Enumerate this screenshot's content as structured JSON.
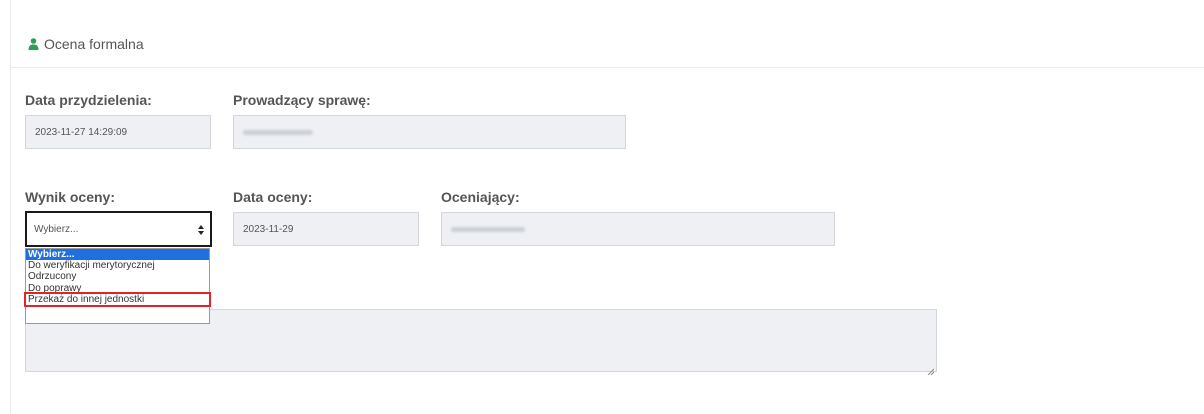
{
  "panel": {
    "title": "Ocena formalna",
    "icon": "user-icon"
  },
  "assignment": {
    "date_label": "Data przydzielenia:",
    "date_value": "2023-11-27 14:29:09",
    "handler_label": "Prowadzący sprawę:"
  },
  "evaluation": {
    "result_label": "Wynik oceny:",
    "result_selected": "Wybierz...",
    "date_label": "Data oceny:",
    "date_value": "2023-11-29",
    "evaluator_label": "Oceniający:"
  },
  "dropdown": {
    "options": [
      "Wybierz...",
      "Do weryfikacji merytorycznej",
      "Odrzucony",
      "Do poprawy",
      "Przekaż do innej jednostki"
    ],
    "selected_option": "Wybierz...",
    "highlight_color": "#e0242a",
    "selected_color": "#1e6fe0"
  },
  "colors": {
    "accent": "#2e9e57",
    "field_bg": "#eef0f3"
  }
}
